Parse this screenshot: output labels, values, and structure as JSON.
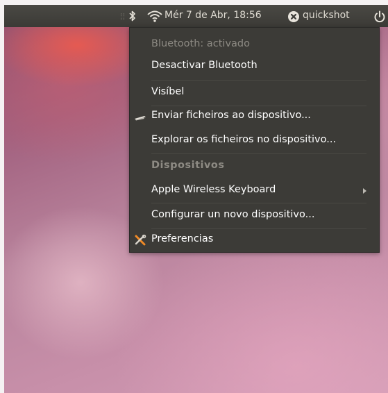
{
  "panel": {
    "datetime": "Mér  7 de Abr, 18:56",
    "user": "quickshot"
  },
  "menu": {
    "items": [
      {
        "label": "Bluetooth: activado",
        "state": "disabled"
      },
      {
        "label": "Desactivar Bluetooth"
      },
      {
        "label": "Visíbel"
      },
      {
        "label": "Enviar ficheiros ao dispositivo...",
        "icon": "send-files-icon"
      },
      {
        "label": "Explorar os ficheiros no dispositivo..."
      },
      {
        "label": "Dispositivos",
        "state": "header"
      },
      {
        "label": "Apple Wireless Keyboard",
        "submenu": true
      },
      {
        "label": "Configurar un novo dispositivo..."
      },
      {
        "label": "Preferencias",
        "icon": "preferences-tools-icon"
      }
    ]
  }
}
